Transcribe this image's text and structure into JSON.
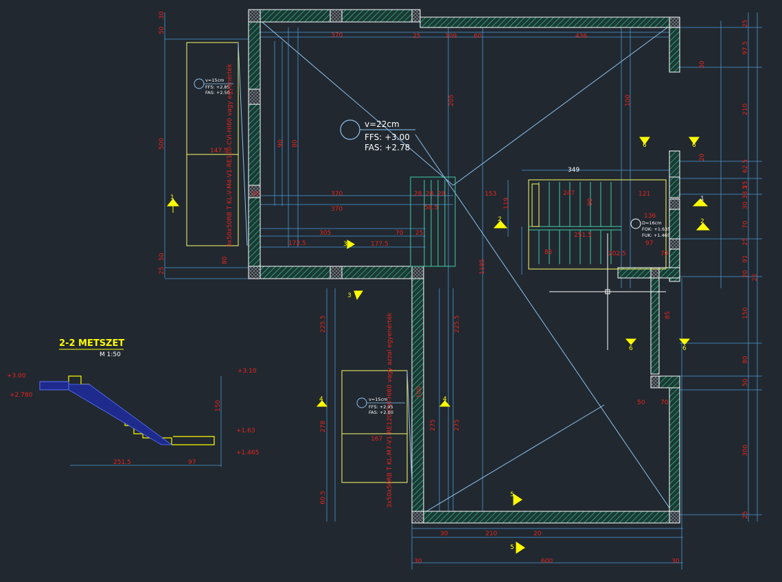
{
  "section": {
    "title": "2-2 METSZET",
    "scale": "M 1:50"
  },
  "main_room": {
    "v": "v=22cm",
    "ffs": "FFS: +3.00",
    "fas": "FAS: +2.78"
  },
  "room_a": {
    "v": "v=15cm",
    "ffs": "FFS: +2.85",
    "fas": "FAS: +2.50"
  },
  "room_b": {
    "v": "v=15cm",
    "ffs": "FFS: +2.95",
    "fas": "FAS: +2.80"
  },
  "stair_room": {
    "v": "D=16cm",
    "fok": "FOK: +1.635",
    "fuk": "FUK: +1.465"
  },
  "door_labels": {
    "left": "3x50x50RB T KL-V-M4-V1-RE120-CVI-HI60 vagy egyenérték",
    "bottom": "3x50x50RB T KL-M7-V1-RE120-CVI-HI60 vagy azzal egyenérték"
  },
  "section_marks": [
    "1",
    "2",
    "3",
    "4",
    "5",
    "6"
  ],
  "dims_top": [
    "370",
    "25",
    "109",
    "60",
    "436"
  ],
  "dims_mid": [
    "30",
    "370",
    "28",
    "28",
    "28",
    "153",
    "247",
    "121",
    "349",
    "370"
  ],
  "dims_bottom": [
    "30",
    "210",
    "20",
    "30",
    "600",
    "30"
  ],
  "dims_left": [
    "30",
    "50",
    "500",
    "50",
    "25",
    "80",
    "91"
  ],
  "dims_right": [
    "25",
    "97.5",
    "30",
    "210",
    "20",
    "62.5",
    "25",
    "38.5",
    "30",
    "70",
    "25",
    "91",
    "20",
    "25",
    "150",
    "80",
    "50",
    "300",
    "25"
  ],
  "dims_section": [
    "251.5",
    "97",
    "150"
  ],
  "misc_dims": [
    "147.5",
    "172.5",
    "177.5",
    "305",
    "70",
    "25",
    "58.5",
    "90",
    "119",
    "136",
    "97",
    "70",
    "202.5",
    "251.5",
    "85",
    "225.5",
    "275",
    "278",
    "167",
    "60.5",
    "100",
    "50",
    "70",
    "180",
    "225",
    "20",
    "80",
    "90",
    "120",
    "25",
    "410",
    "205",
    "100",
    "25",
    "30",
    "380",
    "370"
  ]
}
